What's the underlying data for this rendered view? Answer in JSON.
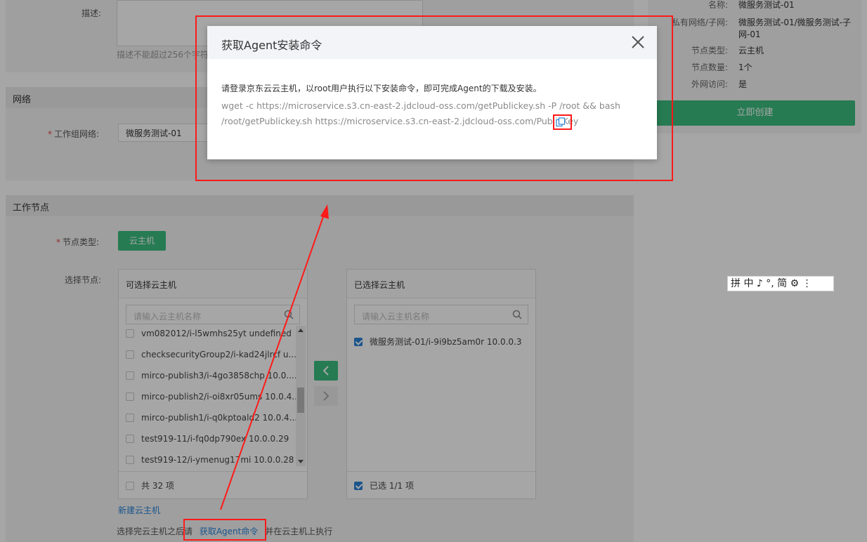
{
  "form": {
    "desc_label": "描述:",
    "desc_hint": "描述不能超过256个字符",
    "network_section": "网络",
    "network_label": "工作组网络:",
    "network_value": "微服务测试-01",
    "nodes_section": "工作节点",
    "node_type_label": "节点类型:",
    "node_type_value": "云主机",
    "select_nodes_label": "选择节点:",
    "new_host_link": "新建云主机",
    "footer_prefix": "选择完云主机之后请",
    "footer_link": "获取Agent命令",
    "footer_suffix": "并在云主机上执行"
  },
  "available": {
    "title": "可选择云主机",
    "search_placeholder": "请输入云主机名称",
    "items": [
      "vm082012/i-l5wmhs25yt undefined",
      "checksecurityGroup2/i-kad24jlrcf u...",
      "mirco-publish3/i-4go3858chp 10.0....",
      "mirco-publish2/i-oi8xr05ums 10.0.4...",
      "mirco-publish1/i-q0kptoald2 10.0.4...",
      "test919-11/i-fq0dp790ex 10.0.0.29",
      "test919-12/i-ymenug17mi 10.0.0.28"
    ],
    "footer": "共 32 项"
  },
  "selected": {
    "title": "已选择云主机",
    "search_placeholder": "请输入云主机名称",
    "items": [
      "微服务测试-01/i-9i9bz5am0r 10.0.0.3"
    ],
    "footer": "已选 1/1 项"
  },
  "summary": {
    "rows": [
      {
        "label": "名称:",
        "value": "微服务测试-01"
      },
      {
        "label": "私有网络/子网:",
        "value": "微服务测试-01/微服务测试-子"
      },
      {
        "label": "",
        "value": "网-01"
      },
      {
        "label": "节点类型:",
        "value": "云主机"
      },
      {
        "label": "节点数量:",
        "value": "1个"
      },
      {
        "label": "外网访问:",
        "value": "是"
      }
    ],
    "create_button": "立即创建"
  },
  "modal": {
    "title": "获取Agent安装命令",
    "description": "请登录京东云云主机，以root用户执行以下安装命令，即可完成Agent的下载及安装。",
    "command_line1": "wget -c https://microservice.s3.cn-east-2.jdcloud-oss.com/getPublickey.sh -P /root && bash",
    "command_line2": "/root/getPublickey.sh https://microservice.s3.cn-east-2.jdcloud-oss.com/PublicKey"
  },
  "ime": {
    "text": "拼 中 ♪ °, 简 ⚙ ⋮"
  },
  "colors": {
    "accent_green": "#3bbd7e",
    "link_blue": "#2a83d8",
    "annotation_red": "#ff1a1a"
  }
}
